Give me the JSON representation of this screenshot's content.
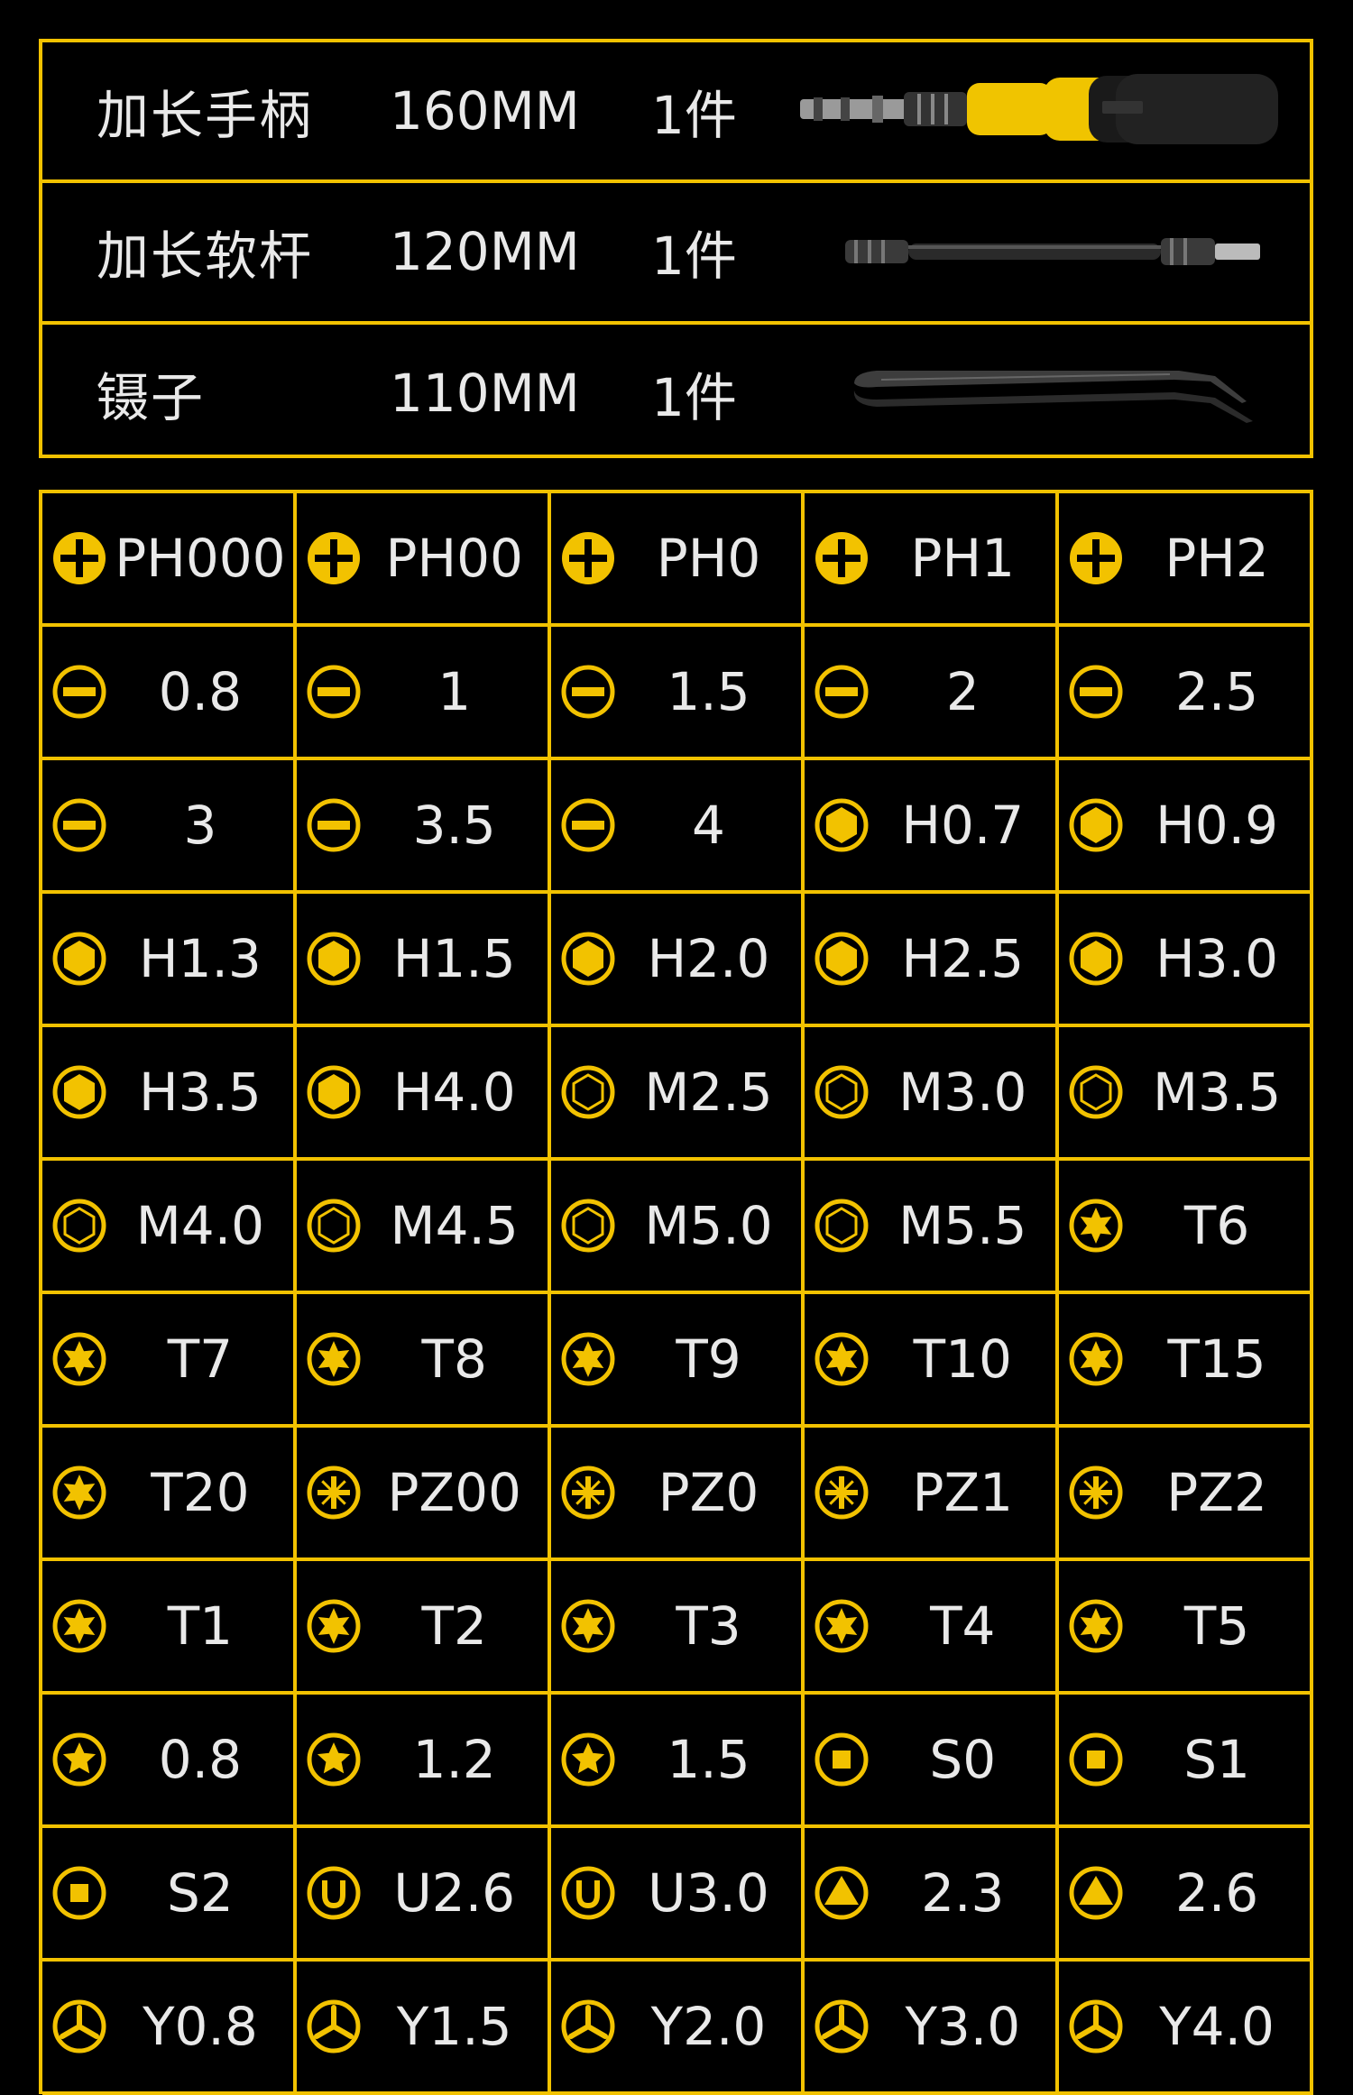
{
  "top_items": [
    {
      "name": "加长手柄",
      "size": "160MM",
      "qty": "1件",
      "image": "screwdriver-handle"
    },
    {
      "name": "加长软杆",
      "size": "120MM",
      "qty": "1件",
      "image": "flexible-shaft"
    },
    {
      "name": "镊子",
      "size": "110MM",
      "qty": "1件",
      "image": "tweezers"
    }
  ],
  "colors": {
    "accent": "#f2c200",
    "background": "#000000",
    "text": "#e9e9e9"
  },
  "rows": [
    [
      {
        "icon": "phillips-icon",
        "label": "PH000"
      },
      {
        "icon": "phillips-icon",
        "label": "PH00"
      },
      {
        "icon": "phillips-icon",
        "label": "PH0"
      },
      {
        "icon": "phillips-icon",
        "label": "PH1"
      },
      {
        "icon": "phillips-icon",
        "label": "PH2"
      }
    ],
    [
      {
        "icon": "slotted-icon",
        "label": "0.8"
      },
      {
        "icon": "slotted-icon",
        "label": "1"
      },
      {
        "icon": "slotted-icon",
        "label": "1.5"
      },
      {
        "icon": "slotted-icon",
        "label": "2"
      },
      {
        "icon": "slotted-icon",
        "label": "2.5"
      }
    ],
    [
      {
        "icon": "slotted-icon",
        "label": "3"
      },
      {
        "icon": "slotted-icon",
        "label": "3.5"
      },
      {
        "icon": "slotted-icon",
        "label": "4"
      },
      {
        "icon": "hex-icon",
        "label": "H0.7"
      },
      {
        "icon": "hex-icon",
        "label": "H0.9"
      }
    ],
    [
      {
        "icon": "hex-icon",
        "label": "H1.3"
      },
      {
        "icon": "hex-icon",
        "label": "H1.5"
      },
      {
        "icon": "hex-icon",
        "label": "H2.0"
      },
      {
        "icon": "hex-icon",
        "label": "H2.5"
      },
      {
        "icon": "hex-icon",
        "label": "H3.0"
      }
    ],
    [
      {
        "icon": "hex-icon",
        "label": "H3.5"
      },
      {
        "icon": "hex-icon",
        "label": "H4.0"
      },
      {
        "icon": "hex-socket-icon",
        "label": "M2.5"
      },
      {
        "icon": "hex-socket-icon",
        "label": "M3.0"
      },
      {
        "icon": "hex-socket-icon",
        "label": "M3.5"
      }
    ],
    [
      {
        "icon": "hex-socket-icon",
        "label": "M4.0"
      },
      {
        "icon": "hex-socket-icon",
        "label": "M4.5"
      },
      {
        "icon": "hex-socket-icon",
        "label": "M5.0"
      },
      {
        "icon": "hex-socket-icon",
        "label": "M5.5"
      },
      {
        "icon": "torx-icon",
        "label": "T6"
      }
    ],
    [
      {
        "icon": "torx-icon",
        "label": "T7"
      },
      {
        "icon": "torx-icon",
        "label": "T8"
      },
      {
        "icon": "torx-icon",
        "label": "T9"
      },
      {
        "icon": "torx-icon",
        "label": "T10"
      },
      {
        "icon": "torx-icon",
        "label": "T15"
      }
    ],
    [
      {
        "icon": "torx-icon",
        "label": "T20"
      },
      {
        "icon": "pozidriv-icon",
        "label": "PZ00"
      },
      {
        "icon": "pozidriv-icon",
        "label": "PZ0"
      },
      {
        "icon": "pozidriv-icon",
        "label": "PZ1"
      },
      {
        "icon": "pozidriv-icon",
        "label": "PZ2"
      }
    ],
    [
      {
        "icon": "torx-icon",
        "label": "T1"
      },
      {
        "icon": "torx-icon",
        "label": "T2"
      },
      {
        "icon": "torx-icon",
        "label": "T3"
      },
      {
        "icon": "torx-icon",
        "label": "T4"
      },
      {
        "icon": "torx-icon",
        "label": "T5"
      }
    ],
    [
      {
        "icon": "pentalobe-icon",
        "label": "0.8"
      },
      {
        "icon": "pentalobe-icon",
        "label": "1.2"
      },
      {
        "icon": "pentalobe-icon",
        "label": "1.5"
      },
      {
        "icon": "square-icon",
        "label": "S0"
      },
      {
        "icon": "square-icon",
        "label": "S1"
      }
    ],
    [
      {
        "icon": "square-icon",
        "label": "S2"
      },
      {
        "icon": "u-shape-icon",
        "label": "U2.6"
      },
      {
        "icon": "u-shape-icon",
        "label": "U3.0"
      },
      {
        "icon": "triangle-icon",
        "label": "2.3"
      },
      {
        "icon": "triangle-icon",
        "label": "2.6"
      }
    ],
    [
      {
        "icon": "tri-wing-icon",
        "label": "Y0.8"
      },
      {
        "icon": "tri-wing-icon",
        "label": "Y1.5"
      },
      {
        "icon": "tri-wing-icon",
        "label": "Y2.0"
      },
      {
        "icon": "tri-wing-icon",
        "label": "Y3.0"
      },
      {
        "icon": "tri-wing-icon",
        "label": "Y4.0"
      }
    ]
  ]
}
